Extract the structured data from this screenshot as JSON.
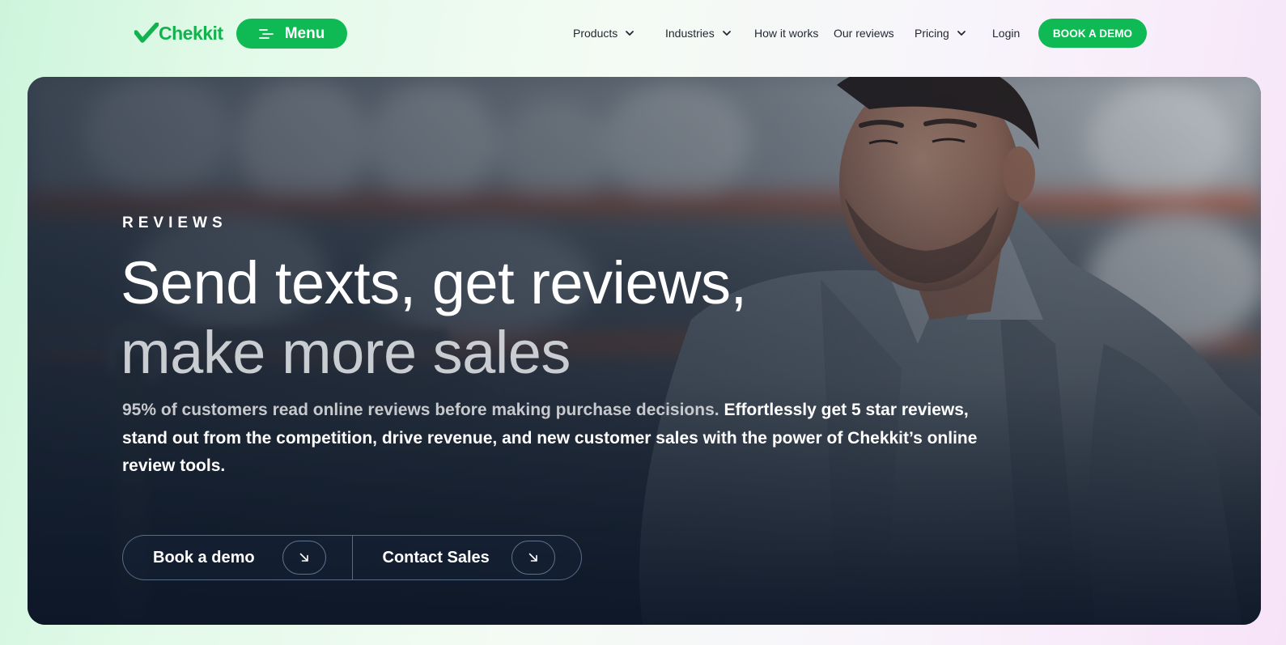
{
  "brand": {
    "name": "Chekkit",
    "color": "#12b24f"
  },
  "header": {
    "menu_label": "Menu",
    "nav": [
      {
        "label": "Products",
        "dropdown": true
      },
      {
        "label": "Industries",
        "dropdown": true
      },
      {
        "label": "How it works",
        "dropdown": false
      },
      {
        "label": "Our reviews",
        "dropdown": false
      },
      {
        "label": "Pricing",
        "dropdown": true
      },
      {
        "label": "Login",
        "dropdown": false
      }
    ],
    "cta_label": "BOOK A DEMO",
    "accent": "#0fb953"
  },
  "hero": {
    "eyebrow": "REVIEWS",
    "headline_line1": "Send texts, get reviews,",
    "headline_line2": "make more sales",
    "subcopy_muted": "95% of customers read online reviews before making purchase decisions.",
    "subcopy_main": " Effortlessly get 5 star reviews, stand out from the competition, drive revenue, and new customer sales with the power of Chekkit’s online review tools.",
    "buttons": [
      {
        "label": "Book a demo",
        "icon": "arrow-down-right-icon"
      },
      {
        "label": "Contact Sales",
        "icon": "arrow-down-right-icon"
      }
    ]
  }
}
